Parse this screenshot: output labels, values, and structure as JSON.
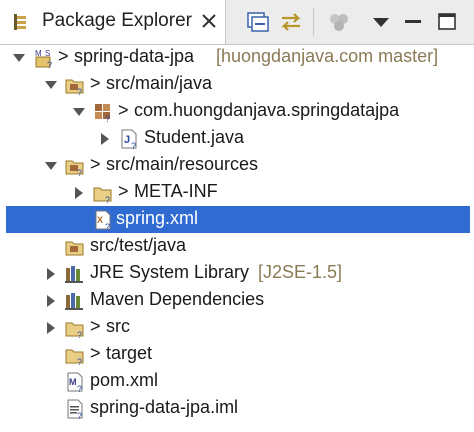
{
  "view": {
    "title": "Package Explorer",
    "toolbar": [
      "collapse-all-icon",
      "link-with-editor-icon",
      "focus-icon",
      "view-menu-icon",
      "minimize-icon",
      "maximize-icon"
    ]
  },
  "tree": {
    "project": {
      "name": "spring-data-jpa",
      "decoration": "[huongdanjava.com master]"
    },
    "src_main_java": {
      "label": "src/main/java"
    },
    "package": {
      "label": "com.huongdanjava.springdatajpa"
    },
    "student": {
      "label": "Student.java"
    },
    "src_main_resources": {
      "label": "src/main/resources"
    },
    "meta_inf": {
      "label": "META-INF"
    },
    "spring_xml": {
      "label": "spring.xml"
    },
    "src_test_java": {
      "label": "src/test/java"
    },
    "jre": {
      "label": "JRE System Library",
      "decoration": "[J2SE-1.5]"
    },
    "maven": {
      "label": "Maven Dependencies"
    },
    "src": {
      "label": "src"
    },
    "target": {
      "label": "target"
    },
    "pom": {
      "label": "pom.xml"
    },
    "iml": {
      "label": "spring-data-jpa.iml"
    },
    "dirty_marker": ">"
  },
  "colors": {
    "selection": "#2f6bd0",
    "decoration": "#8a7a55"
  }
}
